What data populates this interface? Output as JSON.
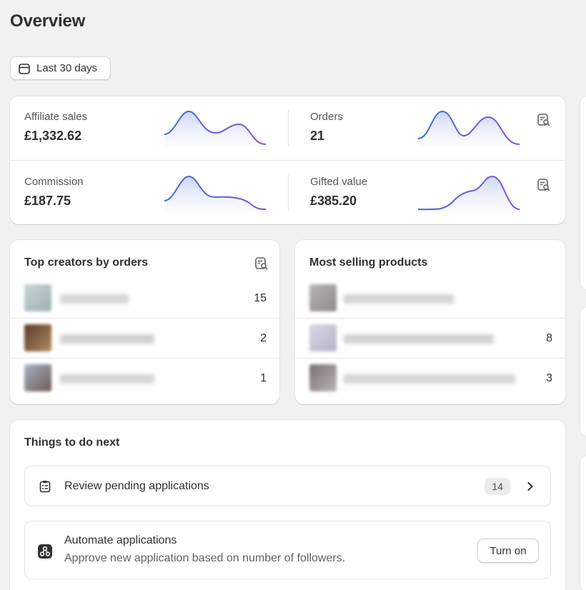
{
  "page": {
    "title": "Overview"
  },
  "date_filter": {
    "label": "Last 30 days",
    "icon": "calendar-icon"
  },
  "metrics": [
    {
      "label": "Affiliate sales",
      "value": "£1,332.62"
    },
    {
      "label": "Orders",
      "value": "21"
    },
    {
      "label": "Commission",
      "value": "£187.75"
    },
    {
      "label": "Gifted value",
      "value": "£385.20"
    }
  ],
  "top_creators": {
    "title": "Top creators by orders",
    "rows": [
      {
        "count": "15"
      },
      {
        "count": "2"
      },
      {
        "count": "1"
      }
    ]
  },
  "top_products": {
    "title": "Most selling products",
    "rows": [
      {
        "count": ""
      },
      {
        "count": "8"
      },
      {
        "count": "3"
      }
    ]
  },
  "todo": {
    "title": "Things to do next",
    "tasks": [
      {
        "label": "Review pending applications",
        "badge": "14",
        "icon": "clipboard-icon"
      },
      {
        "label": "Automate applications",
        "subtitle": "Approve new application based on number of followers.",
        "button_label": "Turn on",
        "icon": "automation-icon"
      }
    ]
  },
  "colors": {
    "accent": "#6b5bd6",
    "spark_top": "#3b6fd0",
    "spark_bottom": "#8a4fd8"
  }
}
